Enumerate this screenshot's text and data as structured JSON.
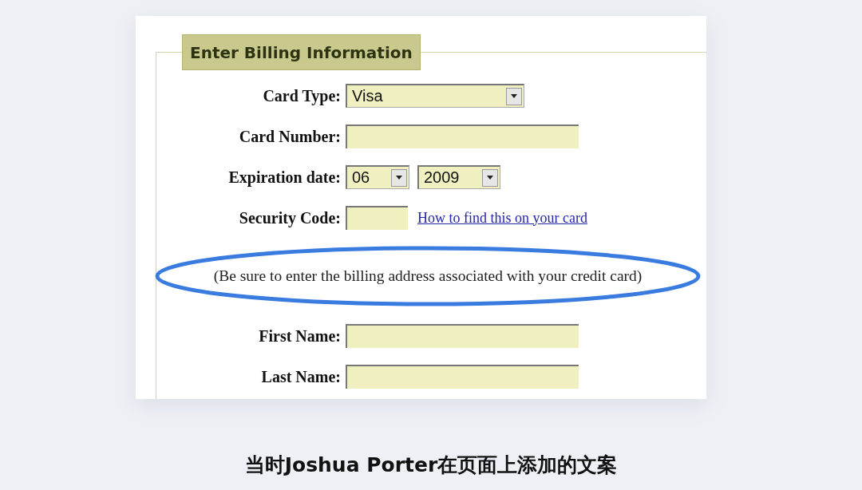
{
  "form": {
    "legend": "Enter Billing Information",
    "fields": [
      {
        "kind": "select",
        "label": "Card Type:",
        "value": "Visa"
      },
      {
        "kind": "text",
        "label": "Card Number:"
      },
      {
        "kind": "date",
        "label": "Expiration date:",
        "selects": [
          "06",
          "2009"
        ]
      },
      {
        "kind": "code",
        "label": "Security Code:",
        "link": "How to find this on your card"
      }
    ],
    "note": "(Be sure to enter the billing address associated with your credit card)",
    "name_fields": [
      {
        "label": "First Name:"
      },
      {
        "label": "Last Name:"
      }
    ]
  },
  "subtitle": "当时Joshua Porter在页面上添加的文案"
}
